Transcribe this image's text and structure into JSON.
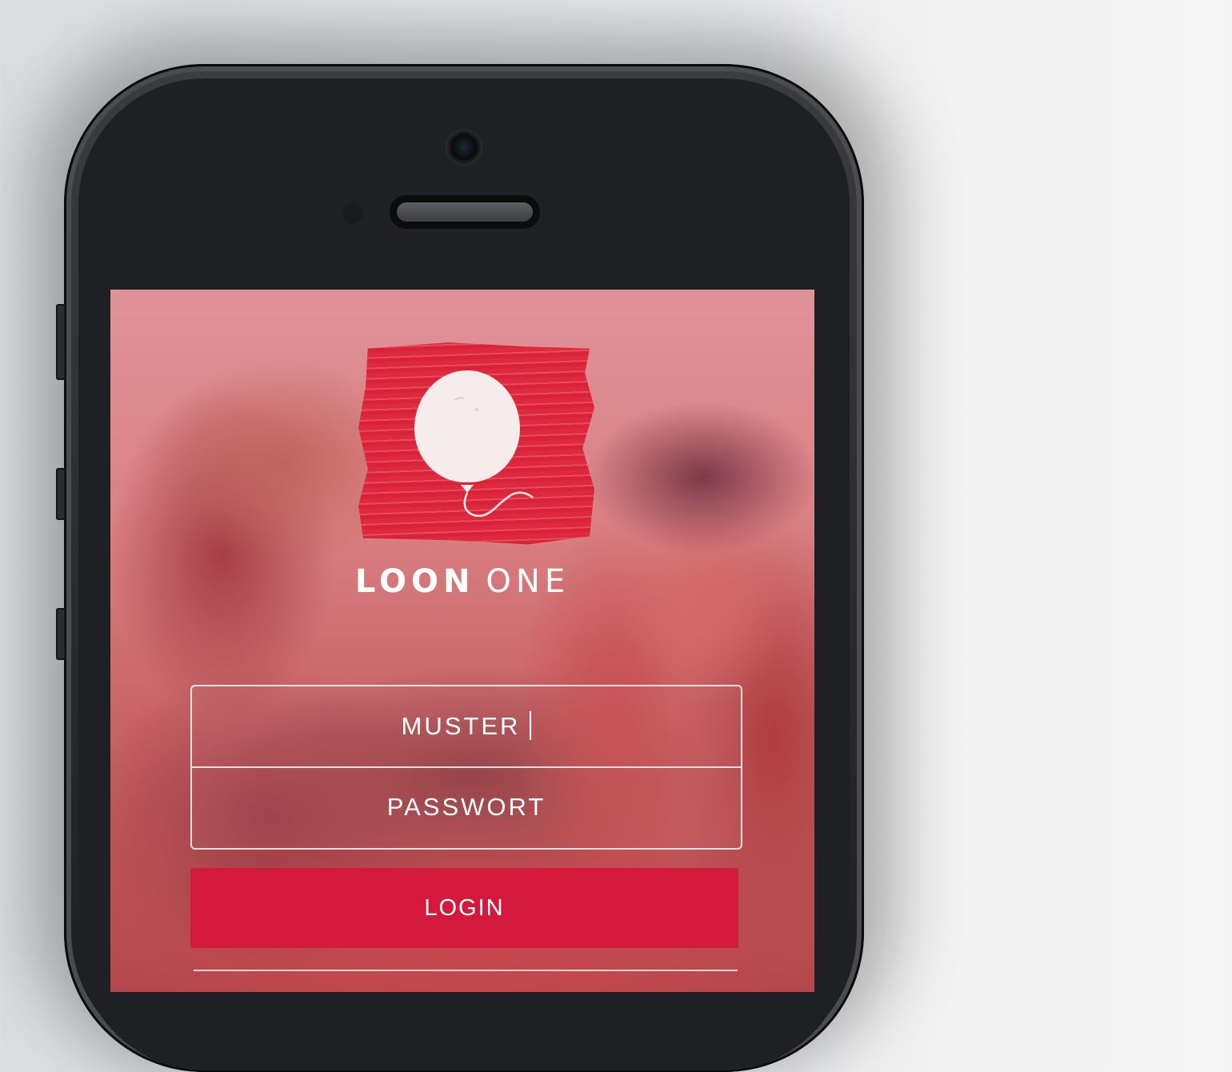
{
  "brand": {
    "name_bold": "LOON",
    "name_light": "ONE"
  },
  "login_form": {
    "username_value": "MUSTER",
    "password_placeholder": "PASSWORT",
    "login_label": "LOGIN"
  },
  "colors": {
    "accent": "#d3193c",
    "logo_red": "#dd2a3f",
    "overlay_pink": "#e85c70"
  },
  "icons": [
    "balloon-logo-icon"
  ]
}
